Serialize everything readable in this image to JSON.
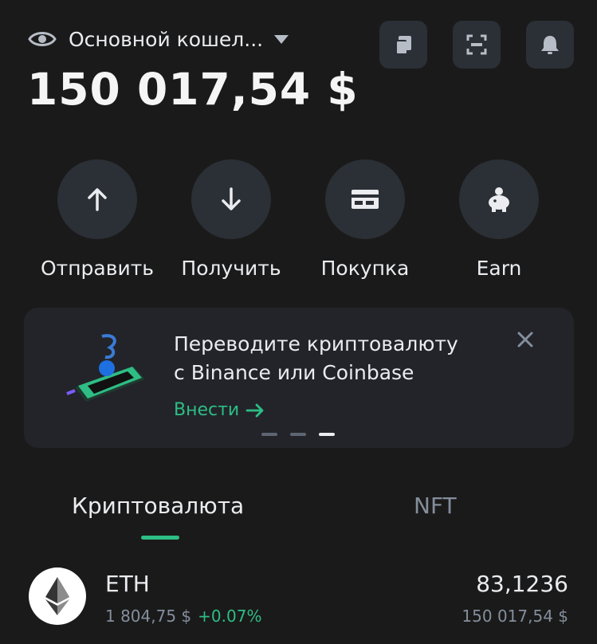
{
  "header": {
    "wallet_name": "Основной кошел...",
    "balance": "150 017,54 $"
  },
  "actions": [
    {
      "label": "Отправить",
      "icon": "arrow-up-icon"
    },
    {
      "label": "Получить",
      "icon": "arrow-down-icon"
    },
    {
      "label": "Покупка",
      "icon": "card-icon"
    },
    {
      "label": "Earn",
      "icon": "piggy-bank-icon"
    }
  ],
  "banner": {
    "line1": "Переводите криптовалюту",
    "line2": "с Binance или Coinbase",
    "cta": "Внести",
    "active_dot": 3,
    "dot_count": 3
  },
  "tabs": [
    {
      "label": "Криптовалюта",
      "active": true
    },
    {
      "label": "NFT",
      "active": false
    }
  ],
  "assets": [
    {
      "symbol": "ETH",
      "price": "1 804,75 $",
      "change": "+0.07%",
      "amount": "83,1236",
      "fiat_value": "150 017,54 $"
    }
  ],
  "colors": {
    "background": "#1a1a1a",
    "surface": "#2b2f36",
    "accent_green": "#2ebd85",
    "muted": "#848e9c"
  }
}
